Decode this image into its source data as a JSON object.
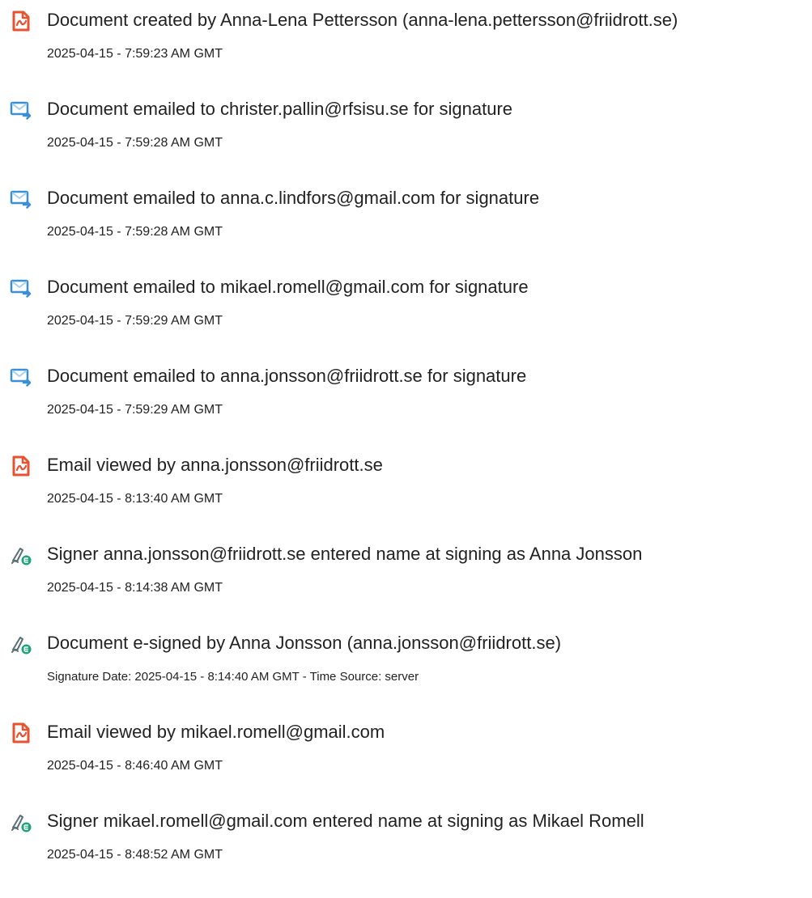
{
  "colors": {
    "text": "#222222",
    "doc_icon": "#e8502f",
    "mail_icon_blue": "#3a8fd6",
    "mail_icon_light": "#a8d0f0",
    "sign_icon_green": "#1fa37a",
    "sign_icon_dark": "#5a6f7a"
  },
  "events": [
    {
      "icon": "document-icon",
      "title": "Document created by Anna-Lena Pettersson (anna-lena.pettersson@friidrott.se)",
      "time": "2025-04-15 - 7:59:23 AM GMT"
    },
    {
      "icon": "email-sent-icon",
      "title": "Document emailed to christer.pallin@rfsisu.se for signature",
      "time": "2025-04-15 - 7:59:28 AM GMT"
    },
    {
      "icon": "email-sent-icon",
      "title": "Document emailed to anna.c.lindfors@gmail.com for signature",
      "time": "2025-04-15 - 7:59:28 AM GMT"
    },
    {
      "icon": "email-sent-icon",
      "title": "Document emailed to mikael.romell@gmail.com for signature",
      "time": "2025-04-15 - 7:59:29 AM GMT"
    },
    {
      "icon": "email-sent-icon",
      "title": "Document emailed to anna.jonsson@friidrott.se for signature",
      "time": "2025-04-15 - 7:59:29 AM GMT"
    },
    {
      "icon": "document-icon",
      "title": "Email viewed by anna.jonsson@friidrott.se",
      "time": "2025-04-15 - 8:13:40 AM GMT"
    },
    {
      "icon": "e-sign-icon",
      "title": "Signer anna.jonsson@friidrott.se entered name at signing as Anna Jonsson",
      "time": "2025-04-15 - 8:14:38 AM GMT"
    },
    {
      "icon": "e-sign-icon",
      "title": "Document e-signed by Anna Jonsson (anna.jonsson@friidrott.se)",
      "time": "Signature Date: 2025-04-15 - 8:14:40 AM GMT - Time Source: server"
    },
    {
      "icon": "document-icon",
      "title": "Email viewed by mikael.romell@gmail.com",
      "time": "2025-04-15 - 8:46:40 AM GMT"
    },
    {
      "icon": "e-sign-icon",
      "title": "Signer mikael.romell@gmail.com entered name at signing as Mikael Romell",
      "time": "2025-04-15 - 8:48:52 AM GMT"
    }
  ]
}
